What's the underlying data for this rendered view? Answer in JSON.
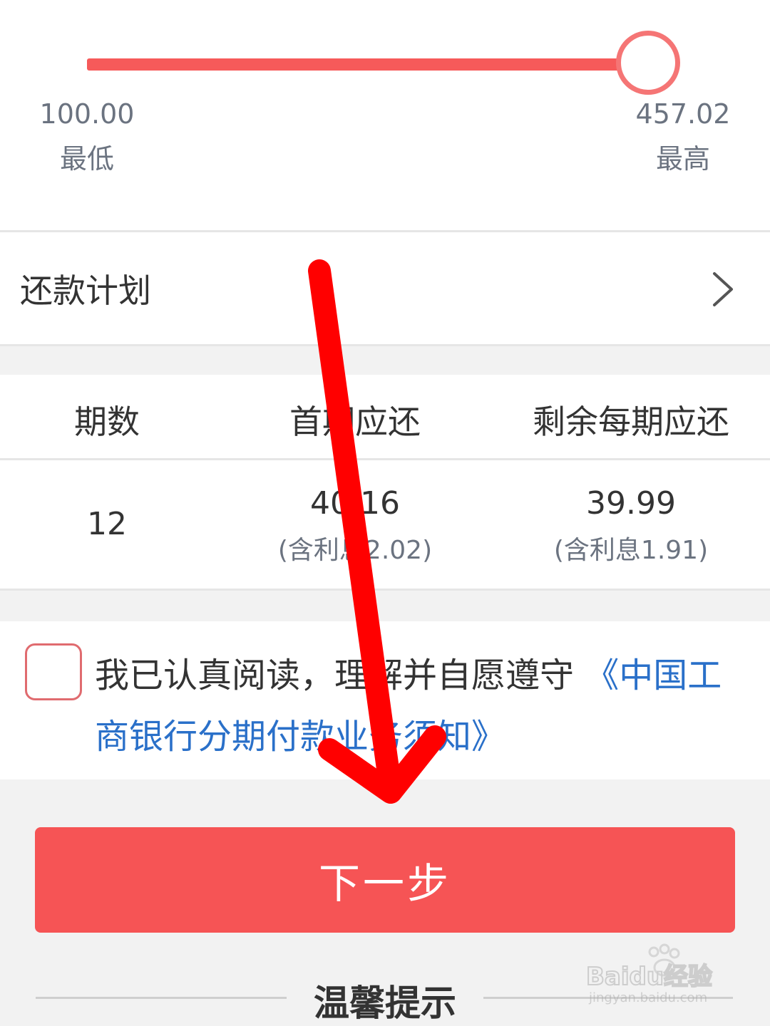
{
  "slider": {
    "min_value": "100.00",
    "min_caption": "最低",
    "max_value": "457.02",
    "max_caption": "最高",
    "selected_fraction": 1.0
  },
  "plan": {
    "label": "还款计划",
    "chevron_icon": "chevron-right-icon"
  },
  "table": {
    "headers": [
      "期数",
      "首期应还",
      "剩余每期应还"
    ],
    "row": {
      "periods": "12",
      "first_amount": "40.16",
      "first_interest": "(含利息2.02)",
      "remaining_amount": "39.99",
      "remaining_interest": "(含利息1.91)"
    }
  },
  "agreement": {
    "text": "我已认真阅读，理解并自愿遵守",
    "link": "《中国工商银行分期付款业务须知》"
  },
  "next_button": {
    "label": "下一步"
  },
  "tips": {
    "title": "温馨提示"
  },
  "watermark": {
    "text": "Baidu经验",
    "url_text": "jingyan.baidu.com"
  },
  "colors": {
    "accent": "#f65455",
    "link": "#2a70c9",
    "annotation_arrow": "#ff0000"
  }
}
